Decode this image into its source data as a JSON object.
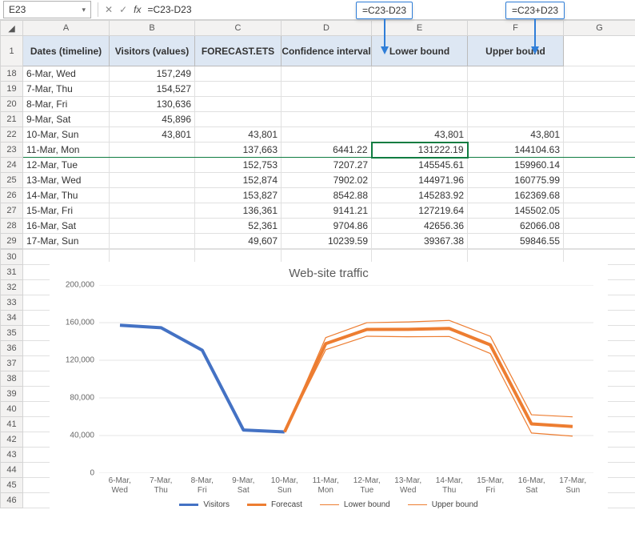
{
  "formula_bar": {
    "cell_ref": "E23",
    "formula": "=C23-D23"
  },
  "callouts": {
    "e_formula": "=C23-D23",
    "f_formula": "=C23+D23"
  },
  "headers": {
    "A": "Dates (timeline)",
    "B": "Visitors (values)",
    "C": "FORECAST.ETS",
    "D": "Confidence interval",
    "E": "Lower bound",
    "F": "Upper bound"
  },
  "columns": [
    "A",
    "B",
    "C",
    "D",
    "E",
    "F",
    "G"
  ],
  "row_nums_top": [
    "1",
    "18",
    "19",
    "20",
    "21",
    "22",
    "23",
    "24",
    "25",
    "26",
    "27",
    "28",
    "29"
  ],
  "row_nums_chart": [
    "30",
    "31",
    "32",
    "33",
    "34",
    "35",
    "36",
    "37",
    "38",
    "39",
    "40",
    "41",
    "42",
    "43",
    "44",
    "45",
    "46"
  ],
  "rows": [
    {
      "date": "6-Mar, Wed",
      "visitors": "157,249",
      "forecast": "",
      "conf": "",
      "lower": "",
      "upper": ""
    },
    {
      "date": "7-Mar, Thu",
      "visitors": "154,527",
      "forecast": "",
      "conf": "",
      "lower": "",
      "upper": ""
    },
    {
      "date": "8-Mar, Fri",
      "visitors": "130,636",
      "forecast": "",
      "conf": "",
      "lower": "",
      "upper": ""
    },
    {
      "date": "9-Mar, Sat",
      "visitors": "45,896",
      "forecast": "",
      "conf": "",
      "lower": "",
      "upper": ""
    },
    {
      "date": "10-Mar, Sun",
      "visitors": "43,801",
      "forecast": "43,801",
      "conf": "",
      "lower": "43,801",
      "upper": "43,801"
    },
    {
      "date": "11-Mar, Mon",
      "visitors": "",
      "forecast": "137,663",
      "conf": "6441.22",
      "lower": "131222.19",
      "upper": "144104.63"
    },
    {
      "date": "12-Mar, Tue",
      "visitors": "",
      "forecast": "152,753",
      "conf": "7207.27",
      "lower": "145545.61",
      "upper": "159960.14"
    },
    {
      "date": "13-Mar, Wed",
      "visitors": "",
      "forecast": "152,874",
      "conf": "7902.02",
      "lower": "144971.96",
      "upper": "160775.99"
    },
    {
      "date": "14-Mar, Thu",
      "visitors": "",
      "forecast": "153,827",
      "conf": "8542.88",
      "lower": "145283.92",
      "upper": "162369.68"
    },
    {
      "date": "15-Mar, Fri",
      "visitors": "",
      "forecast": "136,361",
      "conf": "9141.21",
      "lower": "127219.64",
      "upper": "145502.05"
    },
    {
      "date": "16-Mar, Sat",
      "visitors": "",
      "forecast": "52,361",
      "conf": "9704.86",
      "lower": "42656.36",
      "upper": "62066.08"
    },
    {
      "date": "17-Mar, Sun",
      "visitors": "",
      "forecast": "49,607",
      "conf": "10239.59",
      "lower": "39367.38",
      "upper": "59846.55"
    }
  ],
  "chart_data": {
    "type": "line",
    "title": "Web-site traffic",
    "xlabel": "",
    "ylabel": "",
    "ylim": [
      0,
      200000
    ],
    "y_ticks": [
      "200,000",
      "160,000",
      "120,000",
      "80,000",
      "40,000",
      "0"
    ],
    "categories": [
      "6-Mar, Wed",
      "7-Mar, Thu",
      "8-Mar, Fri",
      "9-Mar, Sat",
      "10-Mar, Sun",
      "11-Mar, Mon",
      "12-Mar, Tue",
      "13-Mar, Wed",
      "14-Mar, Thu",
      "15-Mar, Fri",
      "16-Mar, Sat",
      "17-Mar, Sun"
    ],
    "series": [
      {
        "name": "Visitors",
        "color": "#4472C4",
        "values": [
          157249,
          154527,
          130636,
          45896,
          43801,
          null,
          null,
          null,
          null,
          null,
          null,
          null
        ]
      },
      {
        "name": "Forecast",
        "color": "#ED7D31",
        "values": [
          null,
          null,
          null,
          null,
          43801,
          137663,
          152753,
          152874,
          153827,
          136361,
          52361,
          49607
        ]
      },
      {
        "name": "Lower bound",
        "color": "#ED7D31",
        "values": [
          null,
          null,
          null,
          null,
          43801,
          131222,
          145546,
          144972,
          145284,
          127220,
          42656,
          39367
        ]
      },
      {
        "name": "Upper bound",
        "color": "#ED7D31",
        "values": [
          null,
          null,
          null,
          null,
          43801,
          144105,
          159960,
          160776,
          162370,
          145502,
          62066,
          59847
        ]
      }
    ],
    "legend": [
      "Visitors",
      "Forecast",
      "Lower bound",
      "Upper bound"
    ]
  }
}
